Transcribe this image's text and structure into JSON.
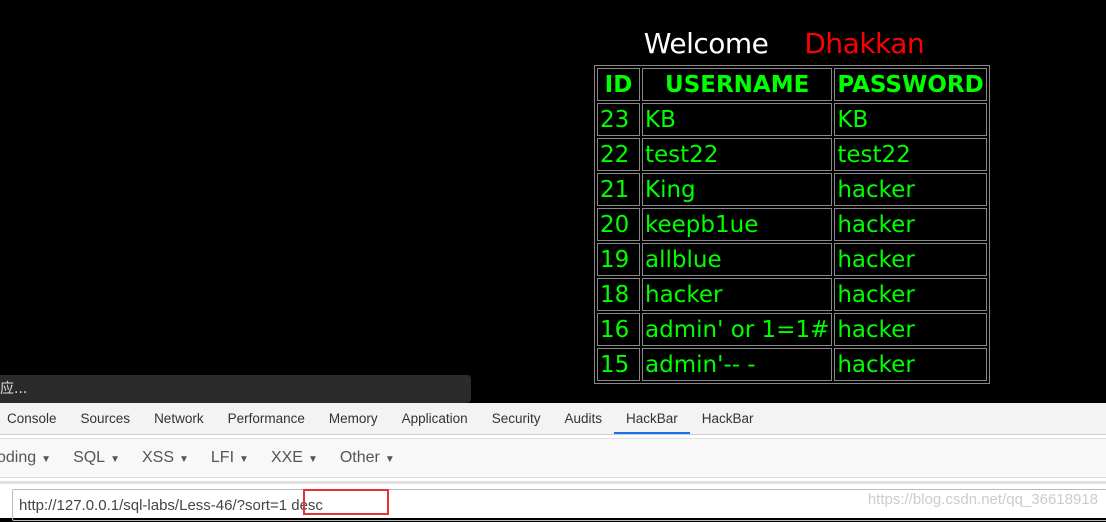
{
  "page": {
    "welcome": "Welcome",
    "name": "Dhakkan"
  },
  "table": {
    "headers": [
      "ID",
      "USERNAME",
      "PASSWORD"
    ],
    "rows": [
      [
        "23",
        "KB",
        "KB"
      ],
      [
        "22",
        "test22",
        "test22"
      ],
      [
        "21",
        "King",
        "hacker"
      ],
      [
        "20",
        "keepb1ue",
        "hacker"
      ],
      [
        "19",
        "allblue",
        "hacker"
      ],
      [
        "18",
        "hacker",
        "hacker"
      ],
      [
        "16",
        "admin' or 1=1#",
        "hacker"
      ],
      [
        "15",
        "admin'-- -",
        "hacker"
      ]
    ]
  },
  "tooltip": "应...",
  "devtools": {
    "tabs": [
      "Console",
      "Sources",
      "Network",
      "Performance",
      "Memory",
      "Application",
      "Security",
      "Audits",
      "HackBar",
      "HackBar"
    ],
    "active_tab": 8,
    "menus": [
      "oding",
      "SQL",
      "XSS",
      "LFI",
      "XXE",
      "Other"
    ],
    "url": "http://127.0.0.1/sql-labs/Less-46/?sort=1 desc"
  },
  "watermark": "https://blog.csdn.net/qq_36618918"
}
